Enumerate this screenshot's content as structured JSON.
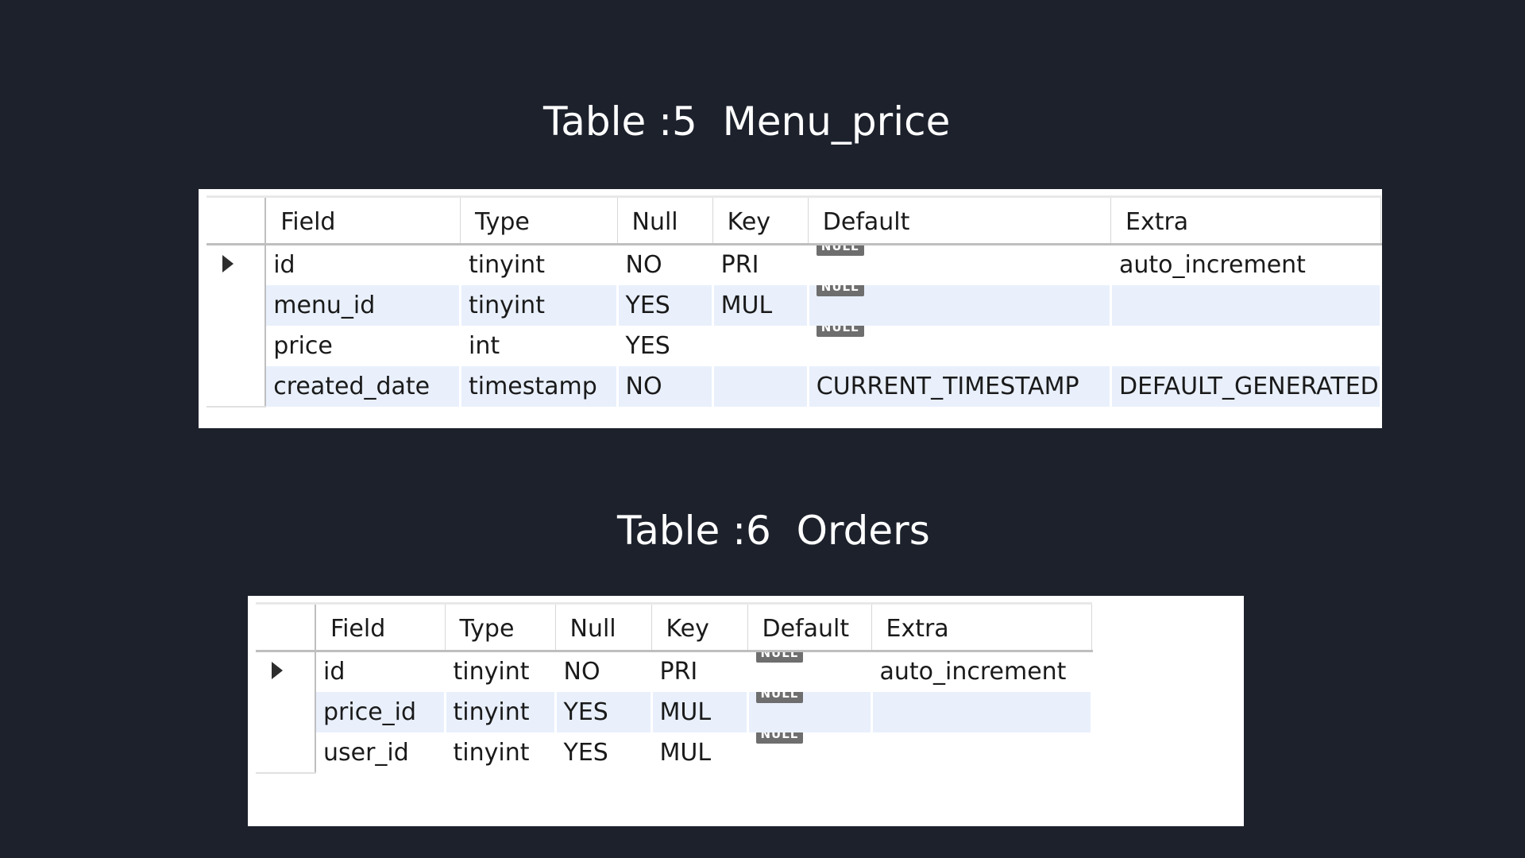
{
  "slide": {
    "title_1": "Table :5  Menu_price",
    "title_2": "Table :6  Orders"
  },
  "columns": [
    "Field",
    "Type",
    "Null",
    "Key",
    "Default",
    "Extra"
  ],
  "null_badge": "NULL",
  "table_menu_price": {
    "rows": [
      {
        "field": "id",
        "type": "tinyint",
        "null": "NO",
        "key": "PRI",
        "default": "NULL",
        "extra": "auto_increment"
      },
      {
        "field": "menu_id",
        "type": "tinyint",
        "null": "YES",
        "key": "MUL",
        "default": "NULL",
        "extra": ""
      },
      {
        "field": "price",
        "type": "int",
        "null": "YES",
        "key": "",
        "default": "NULL",
        "extra": ""
      },
      {
        "field": "created_date",
        "type": "timestamp",
        "null": "NO",
        "key": "",
        "default": "CURRENT_TIMESTAMP",
        "extra": "DEFAULT_GENERATED"
      }
    ]
  },
  "table_orders": {
    "rows": [
      {
        "field": "id",
        "type": "tinyint",
        "null": "NO",
        "key": "PRI",
        "default": "NULL",
        "extra": "auto_increment"
      },
      {
        "field": "price_id",
        "type": "tinyint",
        "null": "YES",
        "key": "MUL",
        "default": "NULL",
        "extra": ""
      },
      {
        "field": "user_id",
        "type": "tinyint",
        "null": "YES",
        "key": "MUL",
        "default": "NULL",
        "extra": ""
      }
    ]
  },
  "colors": {
    "background": "#1c212c",
    "alt_row": "#e9f0fc",
    "null_badge": "#6e6e6e"
  },
  "icons": {
    "row_pointer": "triangle-right-icon"
  }
}
